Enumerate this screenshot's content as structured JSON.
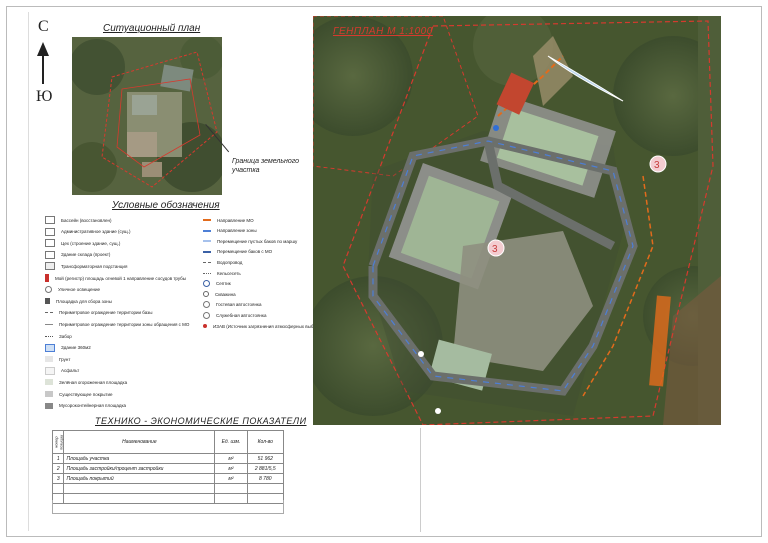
{
  "compass": {
    "north": "С",
    "south": "Ю"
  },
  "situation_plan": {
    "title": "Ситуационный план",
    "boundary_label": "Граница земельного участка"
  },
  "legend": {
    "title": "Условные обозначения",
    "left_items": [
      {
        "label": "Бассейн (восстановлен)",
        "symbol": "box"
      },
      {
        "label": "Административное здание (сущ.)",
        "symbol": "box"
      },
      {
        "label": "Цех (строение здание, сущ.)",
        "symbol": "box"
      },
      {
        "label": "Здание склада (проект)",
        "symbol": "box"
      },
      {
        "label": "Трансформаторная подстанция",
        "symbol": "tp"
      },
      {
        "label": "Мой (регистр) площадь огневой  1 направление сосудов трубы",
        "symbol": "red-marker"
      },
      {
        "label": "Уличное освещение",
        "symbol": "lamp"
      },
      {
        "label": "Площадка для сбора зоны",
        "symbol": "dark-square"
      },
      {
        "label": "Периметровое ограждение территории базы",
        "symbol": "dash-line"
      },
      {
        "label": "Периметровое ограждение территории зоны обращения с МО",
        "symbol": "thin-line"
      },
      {
        "label": "Забор",
        "symbol": "fence"
      },
      {
        "label": "Здание 360м2",
        "symbol": "blue-box"
      },
      {
        "label": "Грунт",
        "symbol": "light-fill"
      },
      {
        "label": "Асфальт",
        "symbol": "white-fill"
      },
      {
        "label": "Зелёная огороженная площадка",
        "symbol": "pale-fill"
      },
      {
        "label": "Существующее покрытие",
        "symbol": "grey-fill"
      },
      {
        "label": "Мусороконтейнерная площадка",
        "symbol": "darkgrey-fill"
      }
    ],
    "right_items": [
      {
        "label": "Направление МО",
        "symbol": "orange-line"
      },
      {
        "label": "Направление зоны",
        "symbol": "blue-line"
      },
      {
        "label": "Перемещение пустых баков по маршу",
        "symbol": "lightblue-line"
      },
      {
        "label": "Перемещение баков с МО",
        "symbol": "blue-dark-line"
      },
      {
        "label": "Водопровод",
        "symbol": "dashed-dot"
      },
      {
        "label": "Кельсесеть",
        "symbol": "dashed-dot2"
      },
      {
        "label": "Септик",
        "symbol": "blue-circle"
      },
      {
        "label": "Скважина",
        "symbol": "small-circle"
      },
      {
        "label": "Гостевая автостоянка",
        "symbol": "num-3"
      },
      {
        "label": "Служебная автостоянка",
        "symbol": "num-3b"
      },
      {
        "label": "ИЗАВ (Источник загрязнения атмосферных выбросов)",
        "symbol": "red-dot"
      }
    ]
  },
  "tep": {
    "title": "ТЕХНИКО - ЭКОНОМИЧЕСКИЕ ПОКАЗАТЕЛИ",
    "headers": {
      "num": "номер позиции",
      "name": "Наименование",
      "unit": "Ед. изм.",
      "qty": "Кол-во"
    },
    "rows": [
      {
        "num": "1",
        "name": "Площадь участка",
        "unit": "м²",
        "qty": "51 962"
      },
      {
        "num": "2",
        "name": "Площадь застройки/процент застройки",
        "unit": "м²",
        "qty": "2 881/5,5"
      },
      {
        "num": "3",
        "name": "Площадь покрытий",
        "unit": "м²",
        "qty": "8 780"
      }
    ]
  },
  "genplan": {
    "title": "ГЕНПЛАН  М 1:1000",
    "parking_marker": "3"
  },
  "colors": {
    "boundary": "#d63a2e",
    "route_mo": "#e26b1c",
    "route_blue": "#4d7fd6"
  }
}
